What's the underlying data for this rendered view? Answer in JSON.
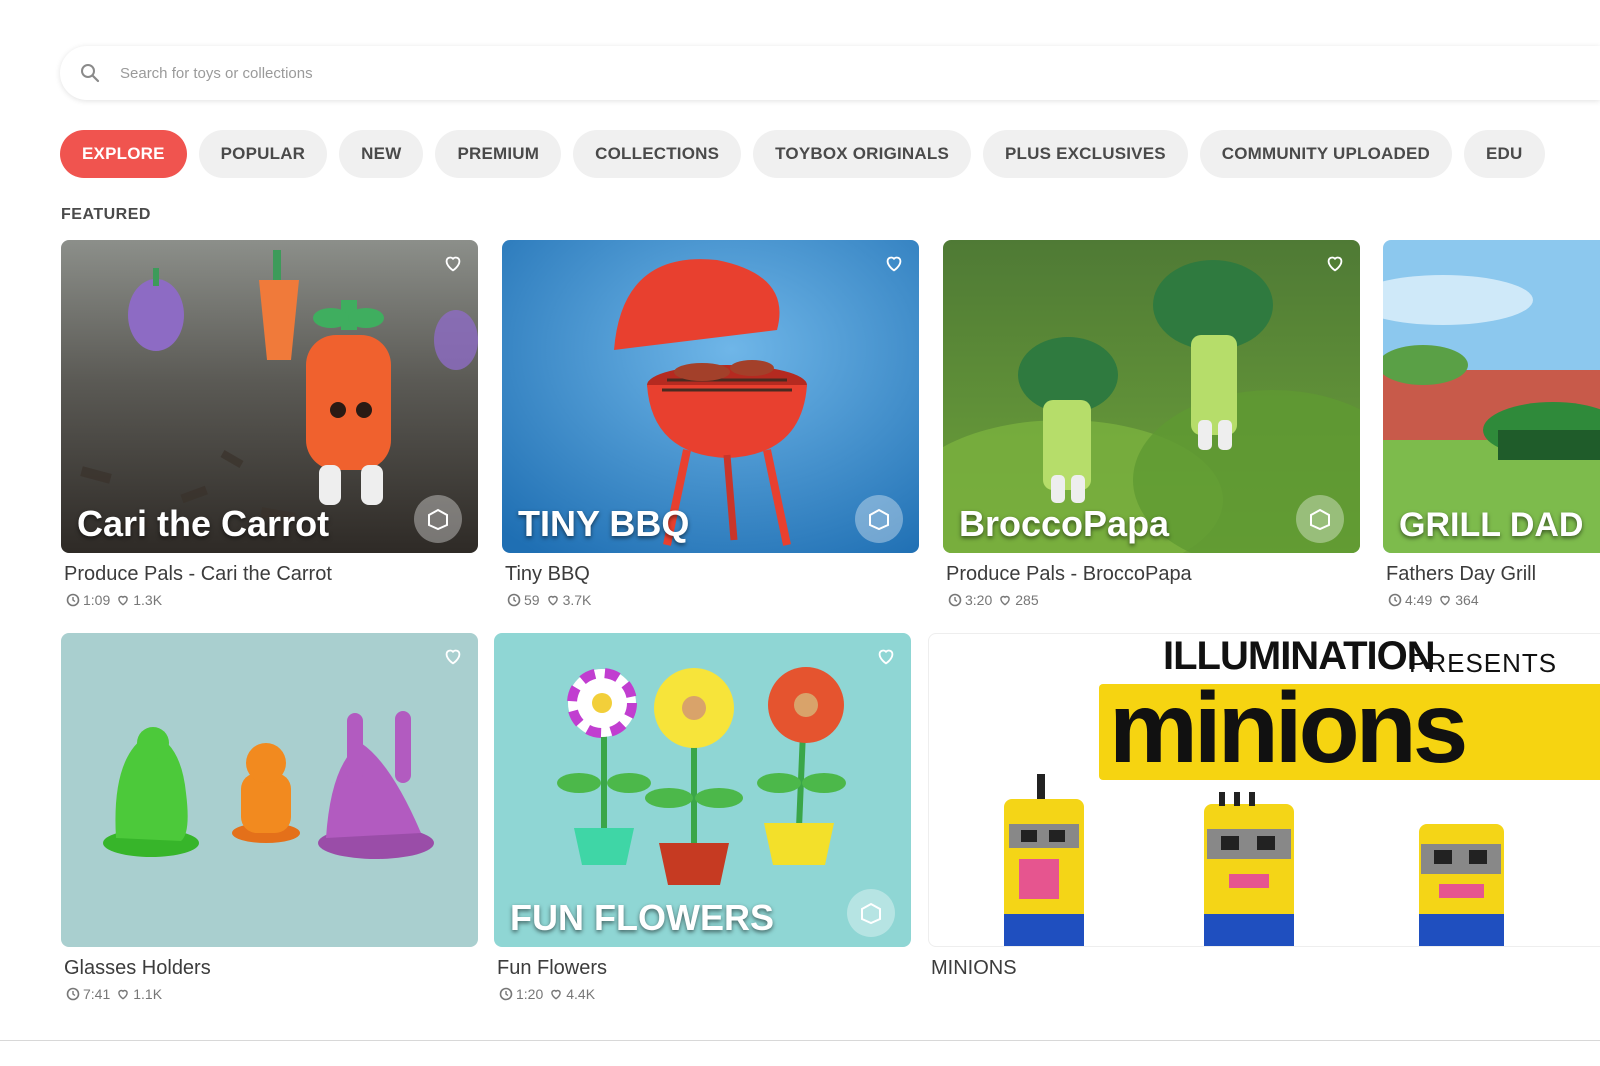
{
  "search": {
    "placeholder": "Search for toys or collections",
    "icon": "search-icon"
  },
  "tabs": [
    {
      "label": "EXPLORE",
      "active": true
    },
    {
      "label": "POPULAR",
      "active": false
    },
    {
      "label": "NEW",
      "active": false
    },
    {
      "label": "PREMIUM",
      "active": false
    },
    {
      "label": "COLLECTIONS",
      "active": false
    },
    {
      "label": "TOYBOX ORIGINALS",
      "active": false
    },
    {
      "label": "PLUS EXCLUSIVES",
      "active": false
    },
    {
      "label": "COMMUNITY UPLOADED",
      "active": false
    },
    {
      "label": "EDU",
      "active": false
    }
  ],
  "section": {
    "title": "FEATURED"
  },
  "cards": [
    {
      "title": "Produce Pals - Cari the Carrot",
      "overlay": "Cari the Carrot",
      "time": "1:09",
      "likes": "1.3K"
    },
    {
      "title": "Tiny BBQ",
      "overlay": "TINY BBQ",
      "time": "59",
      "likes": "3.7K"
    },
    {
      "title": "Produce Pals - BroccoPapa",
      "overlay": "BroccoPapa",
      "time": "3:20",
      "likes": "285"
    },
    {
      "title": "Fathers Day Grill",
      "overlay": "GRILL DAD",
      "time": "4:49",
      "likes": "364"
    },
    {
      "title": "Glasses Holders",
      "overlay": "",
      "time": "7:41",
      "likes": "1.1K"
    },
    {
      "title": "Fun Flowers",
      "overlay": "FUN FLOWERS",
      "time": "1:20",
      "likes": "4.4K"
    },
    {
      "title": "MINIONS",
      "banner_top": "ILLUMINATION",
      "banner_presents": "PRESENTS",
      "banner_logo": "minions"
    }
  ],
  "colors": {
    "accent": "#f0544f",
    "tab_bg": "#f0f0f0"
  }
}
